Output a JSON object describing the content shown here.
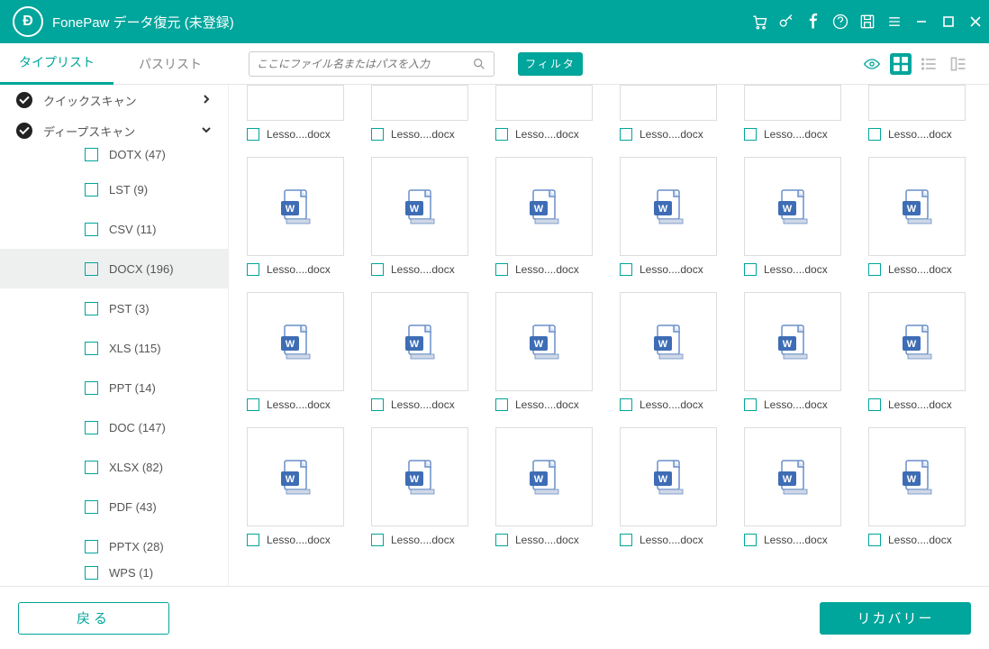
{
  "app": {
    "title": "FonePaw データ復元 (未登録)"
  },
  "toolbar": {
    "tabs": [
      "タイプリスト",
      "パスリスト"
    ],
    "active_tab": 0,
    "search_placeholder": "ここにファイル名またはパスを入力",
    "filter_label": "フィルタ"
  },
  "scans": [
    {
      "label": "クイックスキャン",
      "expanded": false
    },
    {
      "label": "ディープスキャン",
      "expanded": true
    }
  ],
  "filetypes": [
    {
      "label": "DOTX (47)",
      "cut": true
    },
    {
      "label": "LST (9)"
    },
    {
      "label": "CSV (11)"
    },
    {
      "label": "DOCX (196)",
      "selected": true
    },
    {
      "label": "PST (3)"
    },
    {
      "label": "XLS (115)"
    },
    {
      "label": "PPT (14)"
    },
    {
      "label": "DOC (147)"
    },
    {
      "label": "XLSX (82)"
    },
    {
      "label": "PDF (43)"
    },
    {
      "label": "PPTX (28)"
    },
    {
      "label": "WPS (1)",
      "cut": true
    }
  ],
  "files": [
    "Lesso....docx",
    "Lesso....docx",
    "Lesso....docx",
    "Lesso....docx",
    "Lesso....docx",
    "Lesso....docx",
    "Lesso....docx",
    "Lesso....docx",
    "Lesso....docx",
    "Lesso....docx",
    "Lesso....docx",
    "Lesso....docx",
    "Lesso....docx",
    "Lesso....docx",
    "Lesso....docx",
    "Lesso....docx",
    "Lesso....docx",
    "Lesso....docx",
    "Lesso....docx",
    "Lesso....docx",
    "Lesso....docx",
    "Lesso....docx",
    "Lesso....docx",
    "Lesso....docx"
  ],
  "footer": {
    "back": "戻る",
    "recover": "リカバリー"
  }
}
